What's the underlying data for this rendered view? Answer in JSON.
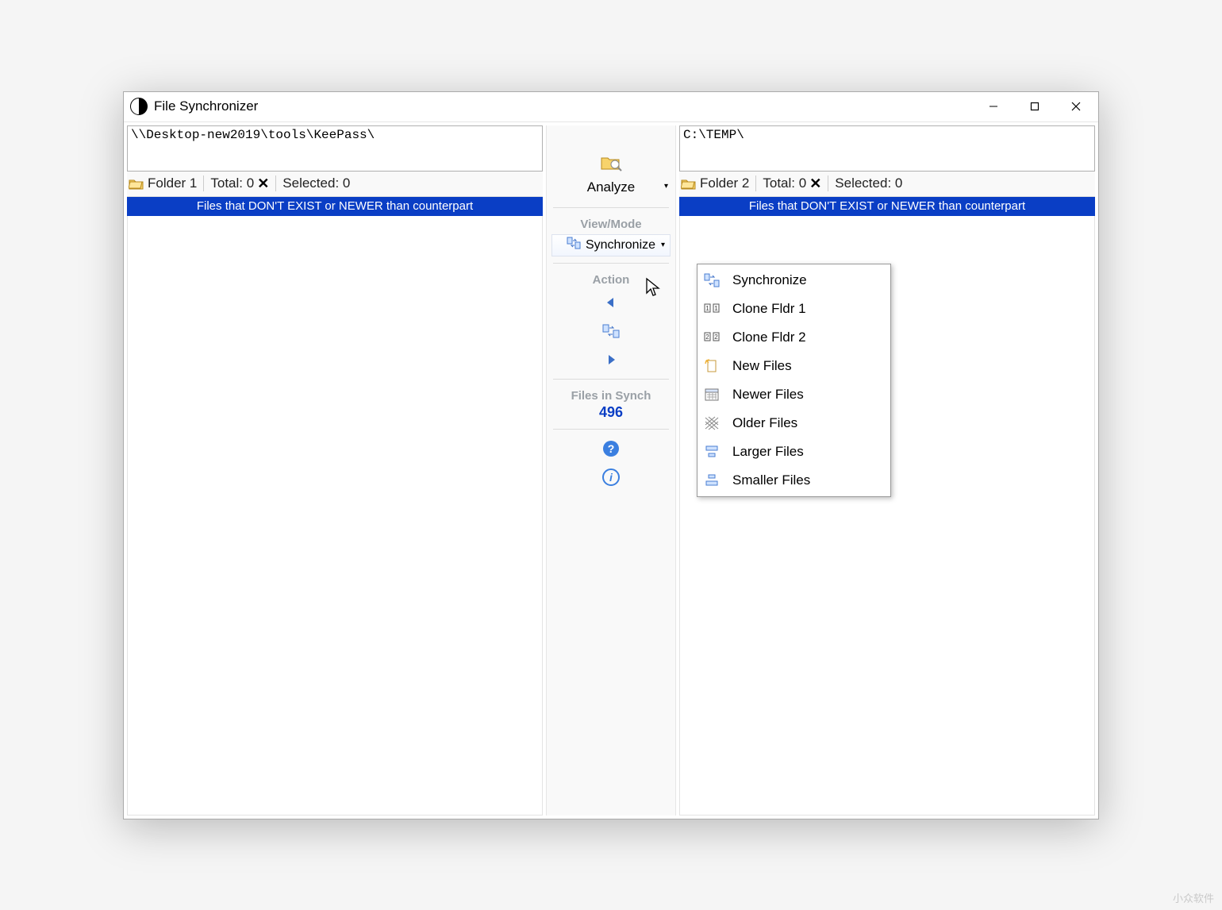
{
  "window": {
    "title": "File Synchronizer"
  },
  "left": {
    "path": "\\\\Desktop-new2019\\tools\\KeePass\\",
    "folder_label": "Folder 1",
    "total_label": "Total: 0",
    "selected_label": "Selected: 0",
    "header": "Files that DON'T EXIST or NEWER than counterpart"
  },
  "right": {
    "path": "C:\\TEMP\\",
    "folder_label": "Folder 2",
    "total_label": "Total: 0",
    "selected_label": "Selected: 0",
    "header": "Files that DON'T EXIST or NEWER than counterpart"
  },
  "center": {
    "analyze_label": "Analyze",
    "viewmode_label": "View/Mode",
    "mode_selected": "Synchronize",
    "action_label": "Action",
    "files_in_synch_label": "Files in Synch",
    "files_in_synch_count": "496"
  },
  "dropdown": {
    "items": [
      {
        "label": "Synchronize"
      },
      {
        "label": "Clone Fldr 1"
      },
      {
        "label": "Clone Fldr 2"
      },
      {
        "label": "New Files"
      },
      {
        "label": "Newer Files"
      },
      {
        "label": "Older Files"
      },
      {
        "label": "Larger Files"
      },
      {
        "label": "Smaller Files"
      }
    ]
  },
  "watermark": "小众软件"
}
